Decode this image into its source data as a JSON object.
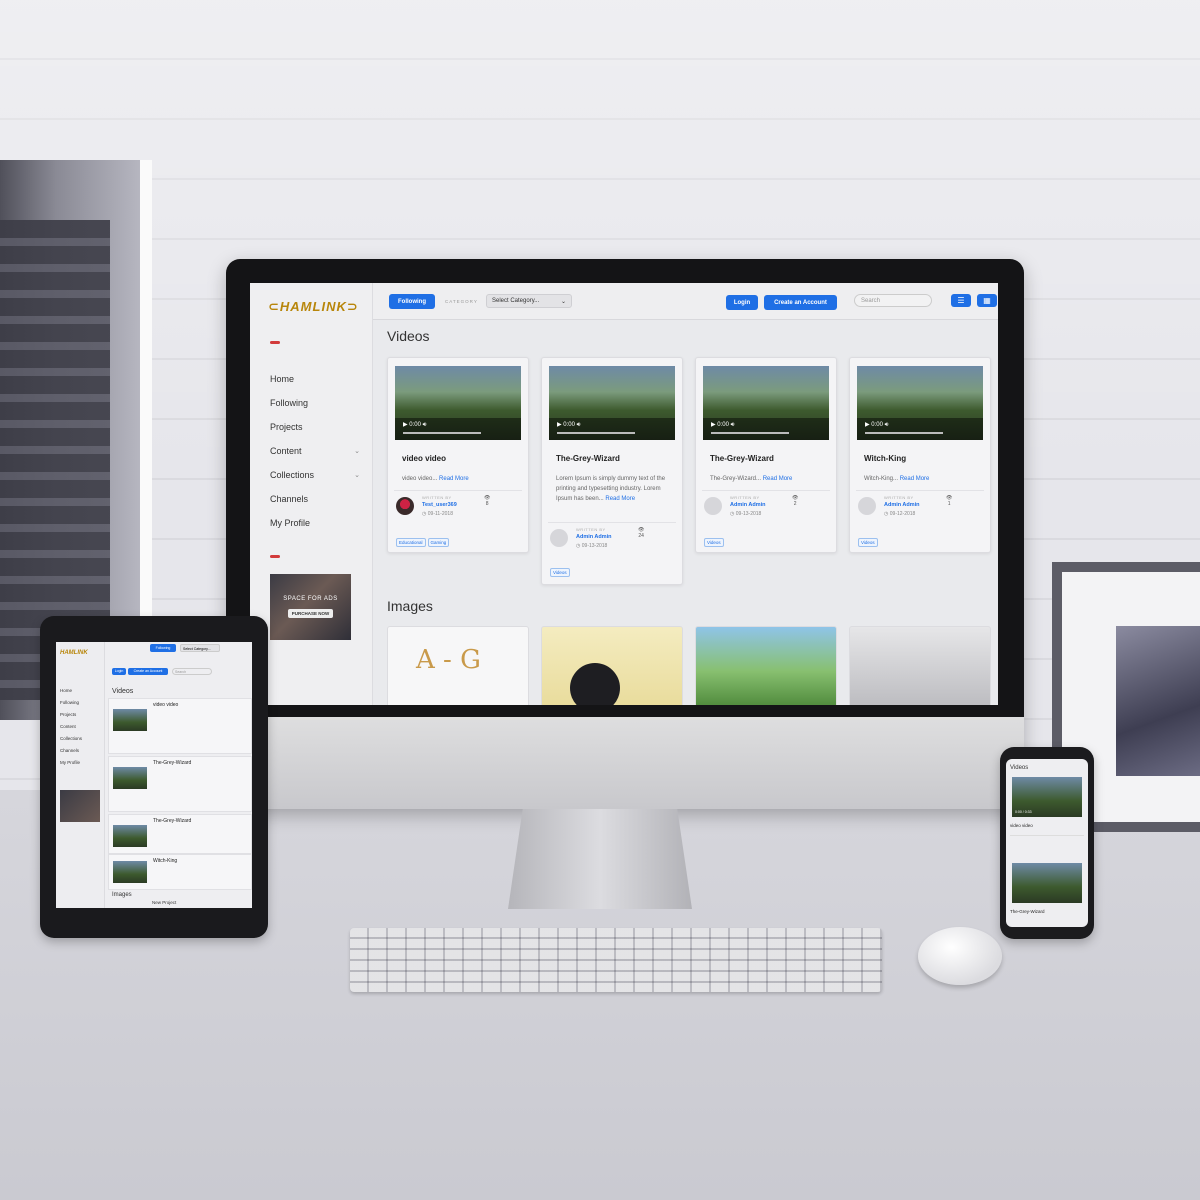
{
  "app": {
    "logo": "HAMLINK"
  },
  "sidebar": {
    "items": [
      {
        "label": "Home",
        "has_children": false
      },
      {
        "label": "Following",
        "has_children": false
      },
      {
        "label": "Projects",
        "has_children": false
      },
      {
        "label": "Content",
        "has_children": true
      },
      {
        "label": "Collections",
        "has_children": true
      },
      {
        "label": "Channels",
        "has_children": false
      },
      {
        "label": "My Profile",
        "has_children": false
      }
    ],
    "ad": {
      "headline": "SPACE FOR ADS",
      "cta": "PURCHASE NOW"
    }
  },
  "topbar": {
    "following_label": "Following",
    "category_label": "CATEGORY",
    "category_select": "Select Category...",
    "login_label": "Login",
    "create_account_label": "Create an Account",
    "search_placeholder": "Search"
  },
  "videos": {
    "section_title": "Videos",
    "time": "0:00",
    "written_by": "WRITTEN BY",
    "read_more": "Read More",
    "cards": [
      {
        "title": "video video",
        "excerpt": "video video...",
        "author": "Test_user369",
        "date": "09-11-2018",
        "views": "8",
        "tags": [
          "Educational",
          "Gaming"
        ]
      },
      {
        "title": "The-Grey-Wizard",
        "excerpt": "Lorem Ipsum is simply dummy text of the printing and typesetting industry. Lorem Ipsum has been...",
        "author": "Admin Admin",
        "date": "09-13-2018",
        "views": "24",
        "tags": [
          "Videos"
        ]
      },
      {
        "title": "The-Grey-Wizard",
        "excerpt": "The-Grey-Wizard...",
        "author": "Admin Admin",
        "date": "09-13-2018",
        "views": "2",
        "tags": [
          "Videos"
        ]
      },
      {
        "title": "Witch-King",
        "excerpt": "Witch-King...",
        "author": "Admin Admin",
        "date": "09-12-2018",
        "views": "1",
        "tags": [
          "Videos"
        ]
      }
    ]
  },
  "images": {
    "section_title": "Images",
    "card1_text": "A - G"
  },
  "tablet": {
    "section_videos": "Videos",
    "section_images": "Images",
    "rows": [
      "video video",
      "The-Grey-Wizard",
      "The-Grey-Wizard",
      "Witch-King"
    ],
    "new_project": "New Project"
  },
  "phone": {
    "section_videos": "Videos",
    "row1_title": "video video",
    "row2_title": "The-Grey-Wizard",
    "time": "0:00 / 0:33"
  },
  "colors": {
    "accent": "#1f6fe5",
    "brand": "#b8860b",
    "marker": "#d23b3b"
  }
}
